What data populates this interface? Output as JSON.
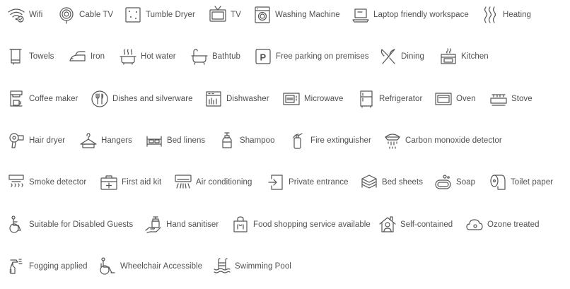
{
  "amenities": [
    {
      "label": "Wifi",
      "icon": "wifi-icon"
    },
    {
      "label": "Cable TV",
      "icon": "cable-tv-icon"
    },
    {
      "label": "Tumble Dryer",
      "icon": "tumble-dryer-icon"
    },
    {
      "label": "TV",
      "icon": "tv-icon"
    },
    {
      "label": "Washing Machine",
      "icon": "washing-machine-icon"
    },
    {
      "label": "Laptop friendly workspace",
      "icon": "laptop-icon"
    },
    {
      "label": "Heating",
      "icon": "heating-icon"
    },
    {
      "label": "Towels",
      "icon": "towels-icon"
    },
    {
      "label": "Iron",
      "icon": "iron-icon"
    },
    {
      "label": "Hot water",
      "icon": "hot-water-icon"
    },
    {
      "label": "Bathtub",
      "icon": "bathtub-icon"
    },
    {
      "label": "Free parking on premises",
      "icon": "parking-icon"
    },
    {
      "label": "Dining",
      "icon": "dining-icon"
    },
    {
      "label": "Kitchen",
      "icon": "kitchen-icon"
    },
    {
      "label": "Coffee maker",
      "icon": "coffee-maker-icon"
    },
    {
      "label": "Dishes and silverware",
      "icon": "dishes-icon"
    },
    {
      "label": "Dishwasher",
      "icon": "dishwasher-icon"
    },
    {
      "label": "Microwave",
      "icon": "microwave-icon"
    },
    {
      "label": "Refrigerator",
      "icon": "refrigerator-icon"
    },
    {
      "label": "Oven",
      "icon": "oven-icon"
    },
    {
      "label": "Stove",
      "icon": "stove-icon"
    },
    {
      "label": "Hair dryer",
      "icon": "hair-dryer-icon"
    },
    {
      "label": "Hangers",
      "icon": "hanger-icon"
    },
    {
      "label": "Bed linens",
      "icon": "bed-icon"
    },
    {
      "label": "Shampoo",
      "icon": "shampoo-icon"
    },
    {
      "label": "Fire extinguisher",
      "icon": "fire-extinguisher-icon"
    },
    {
      "label": "Carbon monoxide detector",
      "icon": "co-detector-icon"
    },
    {
      "label": "Smoke detector",
      "icon": "smoke-detector-icon"
    },
    {
      "label": "First aid kit",
      "icon": "first-aid-icon"
    },
    {
      "label": "Air conditioning",
      "icon": "air-conditioning-icon"
    },
    {
      "label": "Private entrance",
      "icon": "private-entrance-icon"
    },
    {
      "label": "Bed sheets",
      "icon": "bed-sheets-icon"
    },
    {
      "label": "Soap",
      "icon": "soap-icon"
    },
    {
      "label": "Toilet paper",
      "icon": "toilet-paper-icon"
    },
    {
      "label": "Suitable for Disabled Guests",
      "icon": "disabled-icon"
    },
    {
      "label": "Hand sanitiser",
      "icon": "hand-sanitiser-icon"
    },
    {
      "label": "Food shopping service available",
      "icon": "shopping-bag-icon"
    },
    {
      "label": "Self-contained",
      "icon": "house-icon"
    },
    {
      "label": "Ozone treated",
      "icon": "ozone-icon"
    },
    {
      "label": "Fogging applied",
      "icon": "fogging-icon"
    },
    {
      "label": "Wheelchair Accessible",
      "icon": "wheelchair-icon"
    },
    {
      "label": "Swimming Pool",
      "icon": "swimming-pool-icon"
    }
  ]
}
